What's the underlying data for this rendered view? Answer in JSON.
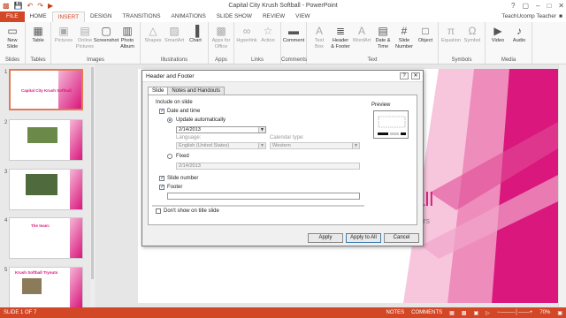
{
  "window": {
    "title": "Capital City Krush Softball - PowerPoint",
    "qat_icons": [
      "save-icon",
      "undo-icon",
      "redo-icon",
      "present-icon"
    ],
    "controls": [
      "?",
      "□",
      "–",
      "□",
      "✕"
    ]
  },
  "tabs": [
    "FILE",
    "HOME",
    "INSERT",
    "DESIGN",
    "TRANSITIONS",
    "ANIMATIONS",
    "SLIDE SHOW",
    "REVIEW",
    "VIEW"
  ],
  "active_tab": "INSERT",
  "user": "TeachUcomp Teacher",
  "ribbon": {
    "groups": [
      {
        "label": "Slides",
        "buttons": [
          {
            "label": "New\nSlide",
            "icon": "new-slide-icon"
          }
        ]
      },
      {
        "label": "Tables",
        "buttons": [
          {
            "label": "Table",
            "icon": "table-icon"
          }
        ]
      },
      {
        "label": "Images",
        "buttons": [
          {
            "label": "Pictures",
            "icon": "pictures-icon"
          },
          {
            "label": "Online\nPictures",
            "icon": "online-pictures-icon"
          },
          {
            "label": "Screenshot",
            "icon": "screenshot-icon"
          },
          {
            "label": "Photo\nAlbum",
            "icon": "photo-album-icon"
          }
        ]
      },
      {
        "label": "Illustrations",
        "buttons": [
          {
            "label": "Shapes",
            "icon": "shapes-icon"
          },
          {
            "label": "SmartArt",
            "icon": "smartart-icon"
          },
          {
            "label": "Chart",
            "icon": "chart-icon"
          }
        ]
      },
      {
        "label": "Apps",
        "buttons": [
          {
            "label": "Apps for\nOffice",
            "icon": "apps-icon"
          }
        ]
      },
      {
        "label": "Links",
        "buttons": [
          {
            "label": "Hyperlink",
            "icon": "hyperlink-icon"
          },
          {
            "label": "Action",
            "icon": "action-icon"
          }
        ]
      },
      {
        "label": "Comments",
        "buttons": [
          {
            "label": "Comment",
            "icon": "comment-icon"
          }
        ]
      },
      {
        "label": "Text",
        "buttons": [
          {
            "label": "Text\nBox",
            "icon": "textbox-icon"
          },
          {
            "label": "Header\n& Footer",
            "icon": "header-footer-icon"
          },
          {
            "label": "WordArt",
            "icon": "wordart-icon"
          },
          {
            "label": "Date &\nTime",
            "icon": "date-time-icon"
          },
          {
            "label": "Slide\nNumber",
            "icon": "slide-number-icon"
          },
          {
            "label": "Object",
            "icon": "object-icon"
          }
        ]
      },
      {
        "label": "Symbols",
        "buttons": [
          {
            "label": "Equation",
            "icon": "equation-icon"
          },
          {
            "label": "Symbol",
            "icon": "symbol-icon"
          }
        ]
      },
      {
        "label": "Media",
        "buttons": [
          {
            "label": "Video",
            "icon": "video-icon"
          },
          {
            "label": "Audio",
            "icon": "audio-icon"
          }
        ]
      }
    ]
  },
  "thumbnails": [
    {
      "num": "1",
      "title": "Capital City Krush Softball"
    },
    {
      "num": "2",
      "title": ""
    },
    {
      "num": "3",
      "title": ""
    },
    {
      "num": "4",
      "title": "The team:"
    },
    {
      "num": "5",
      "title": "Krush Softball Tryouts"
    }
  ],
  "slide": {
    "visible_title_fragment": "ball",
    "visible_subtitle_fragment": "tors"
  },
  "dialog": {
    "title": "Header and Footer",
    "tabs": [
      "Slide",
      "Notes and Handouts"
    ],
    "include_label": "Include on slide",
    "date_time_label": "Date and time",
    "update_auto_label": "Update automatically",
    "date_value": "2/14/2013",
    "language_label": "Language:",
    "language_value": "English (United States)",
    "calendar_label": "Calendar type:",
    "calendar_value": "Western",
    "fixed_label": "Fixed",
    "fixed_value": "2/14/2013",
    "slide_number_label": "Slide number",
    "footer_label": "Footer",
    "footer_value": "",
    "dont_show_label": "Don't show on title slide",
    "preview_label": "Preview",
    "apply_label": "Apply",
    "apply_all_label": "Apply to All",
    "cancel_label": "Cancel"
  },
  "status": {
    "slide_info": "SLIDE 1 OF 7",
    "notes": "NOTES",
    "comments": "COMMENTS",
    "zoom": "70%"
  }
}
